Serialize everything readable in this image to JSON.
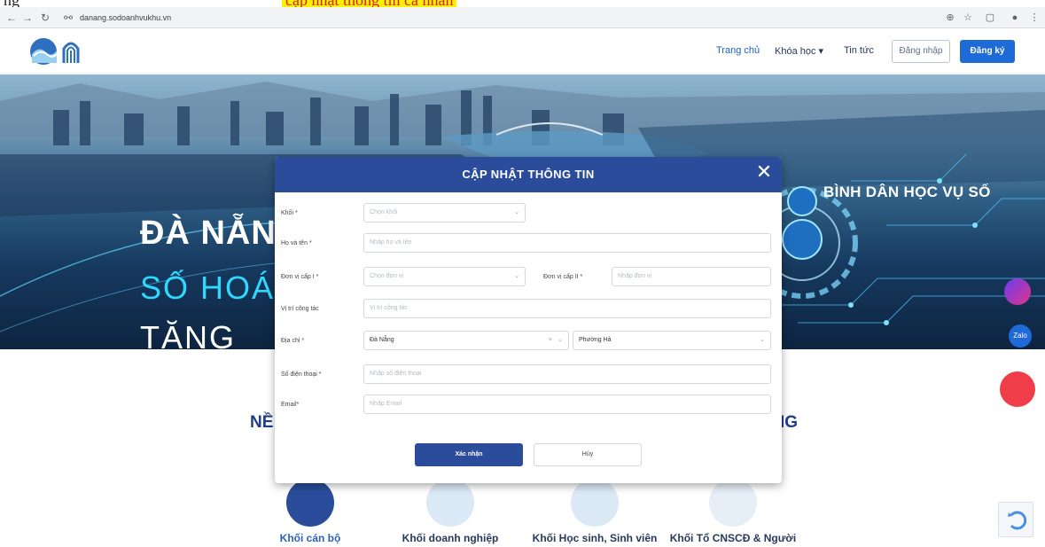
{
  "doc_caption": {
    "prefix": "ng",
    "highlight": "cập nhật thông tin cá nhân"
  },
  "browser": {
    "url": "danang.sodoanhvukhu.vn",
    "icons": [
      "back-icon",
      "forward-icon",
      "reload-icon",
      "site-info-icon",
      "zoom-icon",
      "star-icon",
      "extensions-icon",
      "profile-icon",
      "menu-icon"
    ]
  },
  "header": {
    "nav": {
      "home": "Trang chủ",
      "courses": "Khóa học",
      "news": "Tin tức"
    },
    "login_label": "Đăng nhập",
    "signup_label": "Đăng ký"
  },
  "hero": {
    "title_line1": "ĐÀ NẴNG",
    "title_line2": "SỐ HOÁ",
    "title_line3": "TĂNG",
    "slogan": "BÌNH DÂN HỌC VỤ SỐ"
  },
  "section": {
    "title_left": "NỀ",
    "title_right": "IG"
  },
  "categories": [
    {
      "label": "Khối cán bộ"
    },
    {
      "label": "Khối doanh nghiệp"
    },
    {
      "label": "Khối Học sinh, Sinh viên"
    },
    {
      "label": "Khối Tổ CNSCĐ & Người dân"
    }
  ],
  "floating": {
    "zalo_label": "Zalo"
  },
  "modal": {
    "title": "CẬP NHẬT THÔNG TIN",
    "fields": {
      "block_label": "Khối *",
      "block_placeholder": "Chọn khối",
      "fullname_label": "Họ và tên *",
      "fullname_placeholder": "Nhập họ và tên",
      "unit1_label": "Đơn vị cấp I *",
      "unit1_placeholder": "Chọn đơn vị",
      "unit2_label": "Đơn vị cấp II *",
      "unit2_placeholder": "Nhập đơn vị",
      "workplace_label": "Vị trí công tác",
      "workplace_placeholder": "Vị trí công tác",
      "address_label": "Địa chỉ *",
      "city_value": "Đà Nẵng",
      "ward_value": "Phường Hả",
      "phone_label": "Số điện thoại *",
      "phone_placeholder": "Nhập số điện thoại",
      "email_label": "Email*",
      "email_placeholder": "Nhập Email"
    },
    "confirm_label": "Xác nhận",
    "cancel_label": "Hủy"
  },
  "colors": {
    "brand_blue": "#2a4c9a",
    "accent_blue": "#1e6ad7",
    "hero_cyan": "#31d7ff"
  }
}
